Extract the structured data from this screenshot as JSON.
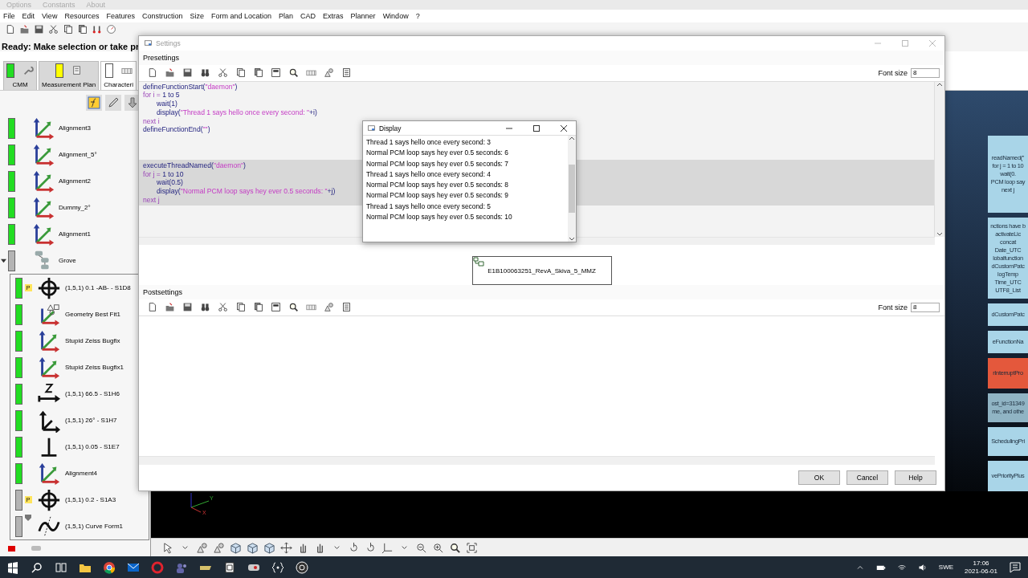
{
  "background_menu": [
    "Options",
    "Constants",
    "About"
  ],
  "menu_bar": [
    "File",
    "Edit",
    "View",
    "Resources",
    "Features",
    "Construction",
    "Size",
    "Form and Location",
    "Plan",
    "CAD",
    "Extras",
    "Planner",
    "Window",
    "?"
  ],
  "status_message": "Ready: Make selection or take pr",
  "mode_tabs": [
    {
      "label": "CMM",
      "color": "#22dd22",
      "selected": false
    },
    {
      "label": "Measurement Plan",
      "color": "#ffff00",
      "selected": false
    },
    {
      "label": "Characteri",
      "color": "#ffffff",
      "selected": true
    }
  ],
  "tree": {
    "items": [
      {
        "label": "Alignment3",
        "color": "#22dd22",
        "kind": "alignment"
      },
      {
        "label": "Alignment_5°",
        "color": "#22dd22",
        "kind": "alignment"
      },
      {
        "label": "Alignment2",
        "color": "#22dd22",
        "kind": "alignment"
      },
      {
        "label": "Dummy_2°",
        "color": "#22dd22",
        "kind": "alignment"
      },
      {
        "label": "Alignment1",
        "color": "#22dd22",
        "kind": "alignment"
      },
      {
        "label": "Grove",
        "color": "#b4b4b4",
        "kind": "group",
        "expanded": true,
        "children": [
          {
            "label": "(1,5,1) 0.1 -AB- - S1D8",
            "color": "#22dd22",
            "kind": "position",
            "badge": "P",
            "locked": false
          },
          {
            "label": "Geometry Best Fit1",
            "color": "#22dd22",
            "kind": "bestfit",
            "locked": false
          },
          {
            "label": "Stupid Zeiss Bugfix",
            "color": "#22dd22",
            "kind": "alignment",
            "locked": false
          },
          {
            "label": "Stupid Zeiss Bugfix1",
            "color": "#22dd22",
            "kind": "alignment",
            "locked": false
          },
          {
            "label": "(1,5,1) 66.5 - S1H6",
            "color": "#22dd22",
            "kind": "distance",
            "locked": false
          },
          {
            "label": "(1,5,1) 26° - S1H7",
            "color": "#22dd22",
            "kind": "angle",
            "locked": false
          },
          {
            "label": "(1,5,1) 0.05 - S1E7",
            "color": "#22dd22",
            "kind": "perpendicular",
            "locked": false
          },
          {
            "label": "Alignment4",
            "color": "#22dd22",
            "kind": "alignment",
            "locked": false
          },
          {
            "label": "(1,5,1) 0.2 - S1A3",
            "color": "#b4b4b4",
            "kind": "position",
            "badge": "P",
            "locked": false
          },
          {
            "label": "(1,5,1) Curve Form1",
            "color": "#b4b4b4",
            "kind": "curve",
            "locked": true
          }
        ]
      }
    ]
  },
  "right_cards": [
    {
      "color": "#a9d5e8",
      "lines": [
        "readNamed(\"",
        "for j = 1 to 10",
        "wait(0.",
        "PCM loop say",
        "next j"
      ]
    },
    {
      "color": "#a9d5e8",
      "lines": [
        "nctions have b",
        "activateLic",
        "concat",
        "Date_UTC",
        "lobalfunction",
        "dCustomPatc",
        "logTemp",
        "Time_UTC",
        "UTF8_List"
      ]
    },
    {
      "color": "#a9d5e8",
      "lines": [
        "dCustomPatc"
      ]
    },
    {
      "color": "#a9d5e8",
      "lines": [
        "eFunctionNa"
      ]
    },
    {
      "color": "#e4583c",
      "lines": [
        "rInterruptPro"
      ]
    },
    {
      "color": "#90b4c4",
      "lines": [
        "ost_id=31349",
        "me, and othe"
      ]
    },
    {
      "color": "#a9d5e8",
      "lines": [
        "SchedulingPri"
      ]
    },
    {
      "color": "#a9d5e8",
      "lines": [
        "vePriorityPlus"
      ]
    }
  ],
  "settings": {
    "title": "Settings",
    "presettings": {
      "label": "Presettings",
      "font_size_label": "Font size",
      "font_size": "8",
      "blocks": [
        {
          "selected": false,
          "lines": [
            {
              "indent": false,
              "tokens": [
                {
                  "kind": "call",
                  "text": "defineFunctionStart("
                },
                {
                  "kind": "string",
                  "text": "\"daemon\""
                },
                {
                  "kind": "call",
                  "text": ")"
                }
              ]
            },
            {
              "indent": false,
              "tokens": [
                {
                  "kind": "keyword",
                  "text": "for i = "
                },
                {
                  "kind": "call",
                  "text": "1 to 5"
                }
              ]
            },
            {
              "indent": true,
              "tokens": [
                {
                  "kind": "call",
                  "text": "wait(1)"
                }
              ]
            },
            {
              "indent": true,
              "tokens": [
                {
                  "kind": "call",
                  "text": "display("
                },
                {
                  "kind": "string",
                  "text": "\"Thread 1 says hello once every second: \""
                },
                {
                  "kind": "call",
                  "text": "+i)"
                }
              ]
            },
            {
              "indent": false,
              "tokens": [
                {
                  "kind": "keyword",
                  "text": "next i"
                }
              ]
            },
            {
              "indent": false,
              "tokens": [
                {
                  "kind": "call",
                  "text": "defineFunctionEnd("
                },
                {
                  "kind": "string",
                  "text": "\"\""
                },
                {
                  "kind": "call",
                  "text": ")"
                }
              ]
            }
          ]
        },
        {
          "selected": true,
          "lines": [
            {
              "indent": false,
              "tokens": [
                {
                  "kind": "call",
                  "text": "executeThreadNamed("
                },
                {
                  "kind": "string",
                  "text": "\"daemon\""
                },
                {
                  "kind": "call",
                  "text": ")"
                }
              ]
            },
            {
              "indent": false,
              "tokens": [
                {
                  "kind": "keyword",
                  "text": "for j = "
                },
                {
                  "kind": "call",
                  "text": "1 to 10"
                }
              ]
            },
            {
              "indent": true,
              "tokens": [
                {
                  "kind": "call",
                  "text": "wait(0.5)"
                }
              ]
            },
            {
              "indent": true,
              "tokens": [
                {
                  "kind": "call",
                  "text": "display("
                },
                {
                  "kind": "string",
                  "text": "\"Normal PCM loop says hey ever 0.5 seconds: \""
                },
                {
                  "kind": "call",
                  "text": "+j)"
                }
              ]
            },
            {
              "indent": false,
              "tokens": [
                {
                  "kind": "keyword",
                  "text": "next j"
                }
              ]
            }
          ]
        }
      ],
      "module": "E1B100063251_RevA_Skiva_5_MMZ"
    },
    "postsettings": {
      "label": "Postsettings",
      "font_size_label": "Font size",
      "font_size": "8"
    },
    "buttons": [
      "OK",
      "Cancel",
      "Help"
    ]
  },
  "display": {
    "title": "Display",
    "lines": [
      "Thread 1 says hello once every second: 3",
      "Normal PCM loop says hey ever 0.5 seconds: 6",
      "Normal PCM loop says hey ever 0.5 seconds: 7",
      "Thread 1 says hello once every second: 4",
      "Normal PCM loop says hey ever 0.5 seconds: 8",
      "Normal PCM loop says hey ever 0.5 seconds: 9",
      "Thread 1 says hello once every second: 5",
      "Normal PCM loop says hey ever 0.5 seconds: 10"
    ]
  },
  "view": {
    "axis_labels": [
      "Y",
      "X"
    ]
  },
  "taskbar": {
    "language": "SWE",
    "time": "17:06",
    "date": "2021-06-01"
  }
}
